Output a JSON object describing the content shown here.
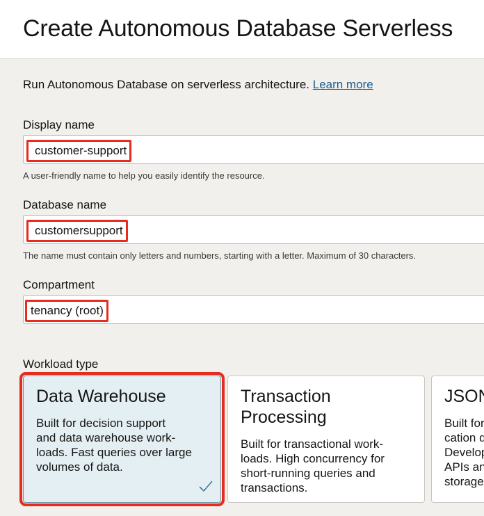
{
  "header": {
    "title": "Create Autonomous Database Serverless"
  },
  "intro": {
    "text": "Run Autonomous Database on serverless architecture. ",
    "link": "Learn more"
  },
  "fields": {
    "display_name": {
      "label": "Display name",
      "value": "customer-support",
      "helper": "A user-friendly name to help you easily identify the resource."
    },
    "database_name": {
      "label": "Database name",
      "value": "customersupport",
      "helper": "The name must contain only letters and numbers, starting with a letter. Maximum of 30 characters."
    },
    "compartment": {
      "label": "Compartment",
      "value": "tenancy (root)"
    }
  },
  "workload": {
    "label": "Workload type",
    "cards": [
      {
        "title": "Data Warehouse",
        "desc_lines": [
          "Built for decision support",
          "and data warehouse work-",
          "loads. Fast queries over large",
          "volumes of data."
        ],
        "selected": true
      },
      {
        "title_lines": [
          "Transaction",
          "Processing"
        ],
        "desc_lines": [
          "Built for transactional work-",
          "loads. High concurrency for",
          "short-running queries and",
          "transactions."
        ],
        "selected": false
      },
      {
        "title": "JSON",
        "desc_lines": [
          "Built for",
          "cation d",
          "Develop",
          "APIs an",
          "storage"
        ],
        "selected": false
      }
    ]
  },
  "colors": {
    "accent_link": "#1d5e8f",
    "highlight": "#e52d1f",
    "selected_card": "#e4eff4",
    "check": "#3b7ea1"
  },
  "icons": {
    "selected_check": "check-icon"
  }
}
